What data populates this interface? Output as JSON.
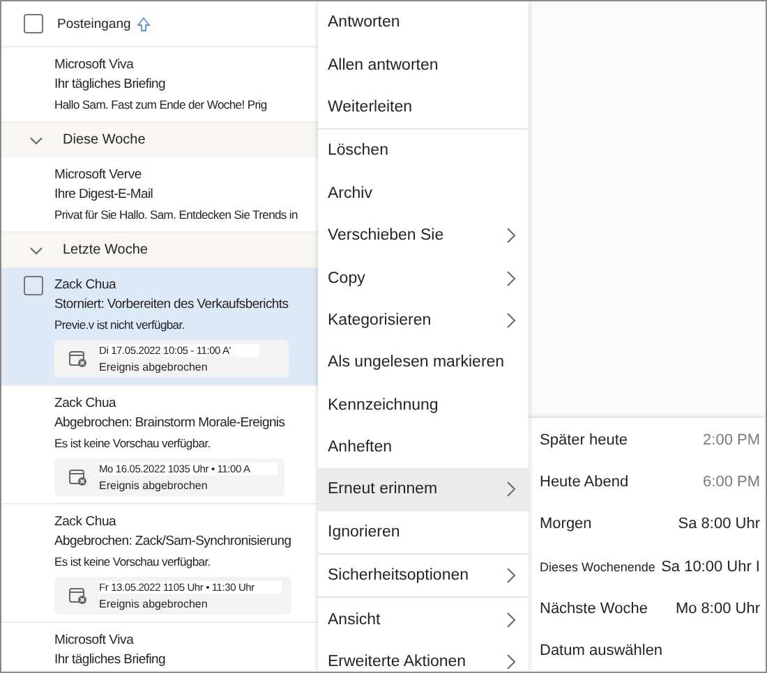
{
  "list": {
    "header": {
      "title": "Posteingang",
      "checked": false
    },
    "items": [
      {
        "kind": "message",
        "sender": "Microsoft Viva",
        "subject": "Ihr tägliches Briefing",
        "preview": "Hallo Sam. Fast zum Ende der Woche! Prig",
        "selected": false
      },
      {
        "kind": "group",
        "label": "Diese Woche",
        "expanded": true
      },
      {
        "kind": "message",
        "sender": "Microsoft Verve",
        "subject": "Ihre Digest-E-Mail",
        "preview": "Privat für Sie Hallo. Sam. Entdecken Sie Trends in",
        "selected": false
      },
      {
        "kind": "group",
        "label": "Letzte Woche",
        "expanded": true
      },
      {
        "kind": "message",
        "sender": "Zack Chua",
        "subject": "Storniert: Vorbereiten des Verkaufsberichts",
        "preview": "Previe.v ist nicht verfügbar.",
        "selected": true,
        "event": {
          "when": "Di 17.05.2022 10:05 - 11:00 A'",
          "status": "Ereignis abgebrochen"
        }
      },
      {
        "kind": "message",
        "sender": "Zack Chua",
        "subject": "Abgebrochen: Brainstorm Morale-Ereignis",
        "preview": "Es ist keine Vorschau verfügbar.",
        "selected": false,
        "event": {
          "when": "Mo 16.05.2022 1035 Uhr • 11:00 A",
          "status": "Ereignis abgebrochen"
        }
      },
      {
        "kind": "message",
        "sender": "Zack Chua",
        "subject": "Abgebrochen: Zack/Sam-Synchronisierung",
        "preview": "Es ist keine Vorschau verfügbar.",
        "selected": false,
        "event": {
          "when": "Fr 13.05.2022 1105 Uhr • 11:30 Uhr",
          "status": "Ereignis abgebrochen"
        }
      },
      {
        "kind": "message",
        "sender": "Microsoft Viva",
        "subject": "Ihr tägliches Briefing",
        "selected": false
      }
    ]
  },
  "menu": {
    "items": [
      {
        "kind": "action",
        "label": "Antworten",
        "submenu": false,
        "hovered": false
      },
      {
        "kind": "action",
        "label": "Allen antworten",
        "submenu": false,
        "hovered": false
      },
      {
        "kind": "action",
        "label": "Weiterleiten",
        "submenu": false,
        "hovered": false
      },
      {
        "kind": "divider"
      },
      {
        "kind": "action",
        "label": "Löschen",
        "submenu": false,
        "hovered": false
      },
      {
        "kind": "action",
        "label": "Archiv",
        "submenu": false,
        "hovered": false
      },
      {
        "kind": "action",
        "label": "Verschieben Sie",
        "submenu": true,
        "hovered": false
      },
      {
        "kind": "action",
        "label": "Copy",
        "submenu": true,
        "hovered": false
      },
      {
        "kind": "action",
        "label": "Kategorisieren",
        "submenu": true,
        "hovered": false
      },
      {
        "kind": "action",
        "label": "Als ungelesen markieren",
        "submenu": false,
        "hovered": false
      },
      {
        "kind": "action",
        "label": "Kennzeichnung",
        "submenu": false,
        "hovered": false
      },
      {
        "kind": "action",
        "label": "Anheften",
        "submenu": false,
        "hovered": false
      },
      {
        "kind": "action",
        "label": "Erneut erinnem",
        "submenu": true,
        "hovered": true
      },
      {
        "kind": "action",
        "label": "Ignorieren",
        "submenu": false,
        "hovered": false
      },
      {
        "kind": "divider"
      },
      {
        "kind": "action",
        "label": "Sicherheitsoptionen",
        "submenu": true,
        "hovered": false
      },
      {
        "kind": "divider"
      },
      {
        "kind": "action",
        "label": "Ansicht",
        "submenu": true,
        "hovered": false
      },
      {
        "kind": "action",
        "label": "Erweiterte Aktionen",
        "submenu": true,
        "hovered": false
      }
    ]
  },
  "submenu": {
    "items": [
      {
        "label": "Später heute",
        "value": "2:00 PM",
        "dimmed": true
      },
      {
        "label": "Heute Abend",
        "value": "6:00 PM",
        "dimmed": true
      },
      {
        "label": "Morgen",
        "value": "Sa 8:00 Uhr",
        "dimmed": false
      },
      {
        "label": "Dieses Wochenende",
        "value": "Sa 10:00 Uhr I",
        "dimmed": false
      },
      {
        "label": "Nächste Woche",
        "value": "Mo 8:00 Uhr",
        "dimmed": false
      },
      {
        "label": "Datum auswählen"
      }
    ]
  }
}
